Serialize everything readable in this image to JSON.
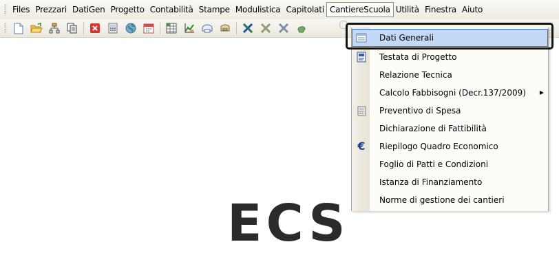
{
  "menubar": {
    "items": [
      {
        "label": "Files"
      },
      {
        "label": "Prezzari"
      },
      {
        "label": "DatiGen"
      },
      {
        "label": "Progetto"
      },
      {
        "label": "Contabilità"
      },
      {
        "label": "Stampe"
      },
      {
        "label": "Modulistica"
      },
      {
        "label": "Capitolati"
      },
      {
        "label": "CantiereScuola"
      },
      {
        "label": "Utilità"
      },
      {
        "label": "Finestra"
      },
      {
        "label": "Aiuto"
      }
    ],
    "active": "CantiereScuola"
  },
  "toolbar": {
    "icons": [
      "new-document-icon",
      "open-folder-icon",
      "hierarchy-icon",
      "copy-icon",
      "close-red-icon",
      "calculator-icon",
      "globe-icon",
      "calendar-icon",
      "table-icon",
      "chart-icon",
      "print-icon",
      "scanner-icon",
      "excel-icon",
      "excel-gray-icon",
      "excel-gray-2-icon",
      "bulb-icon"
    ]
  },
  "dropdown": {
    "items": [
      {
        "label": "Dati Generali",
        "icon": "form-icon",
        "highlighted": true
      },
      {
        "label": "Testata di Progetto",
        "icon": "document-header-icon"
      },
      {
        "label": "Relazione Tecnica",
        "icon": ""
      },
      {
        "label": "Calcolo Fabbisogni (Decr.137/2009)",
        "icon": "",
        "submenu": true
      },
      {
        "label": "Preventivo di Spesa",
        "icon": "calculator-icon"
      },
      {
        "label": "Dichiarazione di Fattibilità",
        "icon": ""
      },
      {
        "label": "Riepilogo Quadro Economico",
        "icon": "euro-icon"
      },
      {
        "label": "Foglio di Patti e Condizioni",
        "icon": ""
      },
      {
        "label": "Istanza di Finanziamento",
        "icon": ""
      },
      {
        "label": "Norme di gestione dei cantieri",
        "icon": ""
      }
    ]
  },
  "colors": {
    "highlight_bg": "#c4d9f6",
    "highlight_border": "#3a6ec5",
    "euro": "#1a3c8c"
  }
}
